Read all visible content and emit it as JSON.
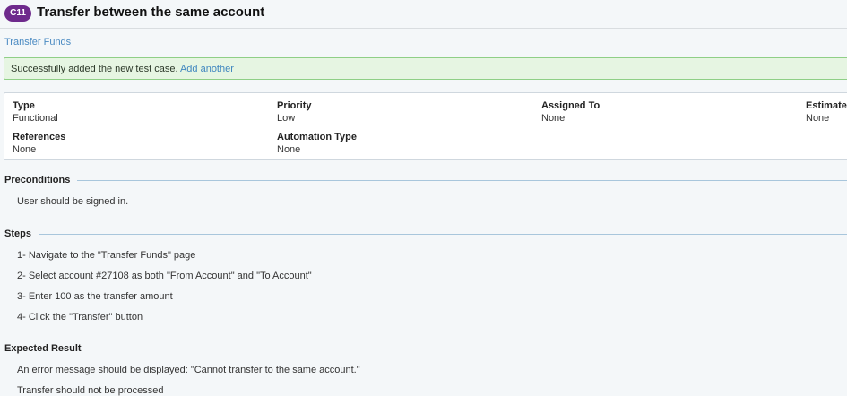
{
  "header": {
    "badge": "C11",
    "title": "Transfer between the same account"
  },
  "breadcrumb": "Transfer Funds",
  "banner": {
    "message": "Successfully added the new test case.",
    "link": "Add another"
  },
  "details": {
    "type": {
      "label": "Type",
      "value": "Functional"
    },
    "priority": {
      "label": "Priority",
      "value": "Low"
    },
    "assigned_to": {
      "label": "Assigned To",
      "value": "None"
    },
    "estimate": {
      "label": "Estimate",
      "value": "None"
    },
    "references": {
      "label": "References",
      "value": "None"
    },
    "automation_type": {
      "label": "Automation Type",
      "value": "None"
    }
  },
  "preconditions": {
    "heading": "Preconditions",
    "text": "User should be signed in."
  },
  "steps": {
    "heading": "Steps",
    "items": [
      "1- Navigate to the \"Transfer Funds\" page",
      "2- Select account #27108 as both \"From Account\" and \"To Account\"",
      "3- Enter 100 as the transfer amount",
      "4- Click the \"Transfer\" button"
    ]
  },
  "expected": {
    "heading": "Expected Result",
    "items": [
      "An error message should be displayed: \"Cannot transfer to the same account.\"",
      "Transfer should not be processed"
    ]
  },
  "colors": {
    "badge": "#6e2a8c",
    "link": "#4a8ac2",
    "success_bg": "#e6f5e2",
    "success_border": "#8fcf86",
    "section_rule": "#a8c6dc"
  }
}
